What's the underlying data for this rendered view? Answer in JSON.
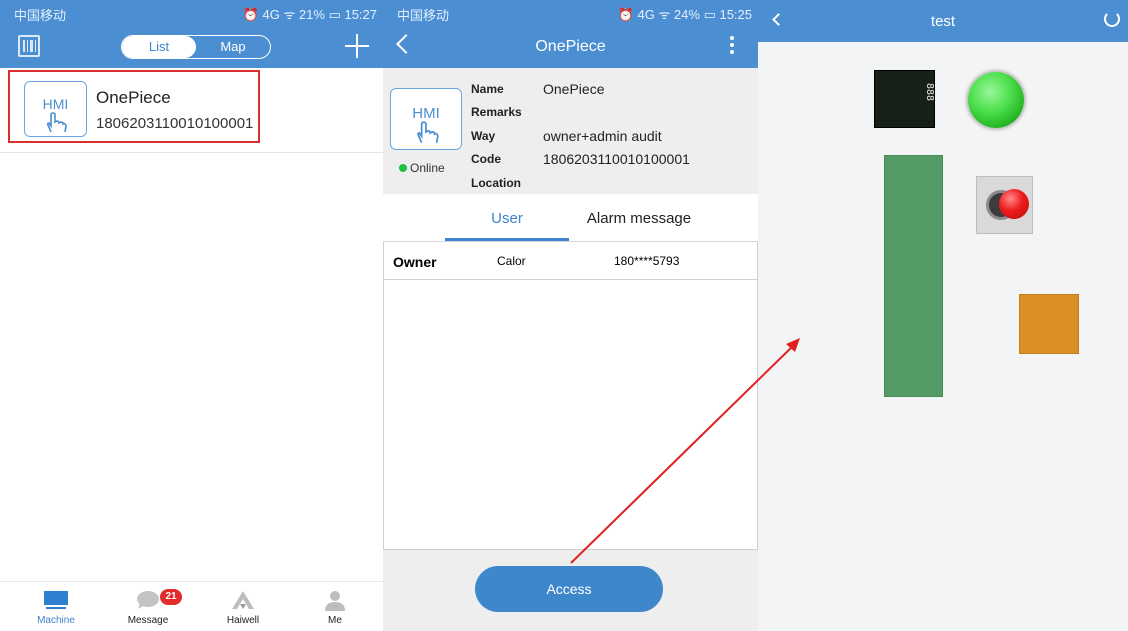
{
  "screen1": {
    "status": {
      "carrier": "中国移动",
      "right": "⏰ 4G ᯤ 21% ▭ 15:27"
    },
    "segment": {
      "list": "List",
      "map": "Map"
    },
    "machine": {
      "badge": "HMI",
      "name": "OnePiece",
      "code": "1806203110010100001"
    },
    "tabs": [
      {
        "label": "Machine",
        "icon": "monitor-icon",
        "active": true
      },
      {
        "label": "Message",
        "icon": "chat-bubble-icon",
        "badge": "21"
      },
      {
        "label": "Haiwell",
        "icon": "haiwell-logo-icon"
      },
      {
        "label": "Me",
        "icon": "person-icon"
      }
    ]
  },
  "screen2": {
    "status": {
      "carrier": "中国移动",
      "right": "⏰ 4G ᯤ 24% ▭ 15:25"
    },
    "title": "OnePiece",
    "device": {
      "badge": "HMI",
      "status": "Online",
      "fields": [
        {
          "key": "Name",
          "value": "OnePiece"
        },
        {
          "key": "Remarks",
          "value": ""
        },
        {
          "key": "Way",
          "value": "owner+admin audit"
        },
        {
          "key": "Code",
          "value": "1806203110010100001"
        },
        {
          "key": "Location",
          "value": ""
        }
      ]
    },
    "tabs": {
      "user": "User",
      "alarm": "Alarm message"
    },
    "owner_row": {
      "role": "Owner",
      "name": "Calor",
      "phone": "180****5793"
    },
    "access_button": "Access"
  },
  "screen3": {
    "title": "test",
    "display_digits": "888",
    "colors": {
      "lamp": "#4ee04e",
      "bar": "#549b67",
      "switch": "#ee1a1a",
      "block": "#db8f27",
      "annotation": "#e02020"
    }
  },
  "colors": {
    "brand": "#4b8fd2",
    "highlight_border": "#d8302e",
    "online": "#22c13b",
    "badge": "#e22c2c"
  }
}
